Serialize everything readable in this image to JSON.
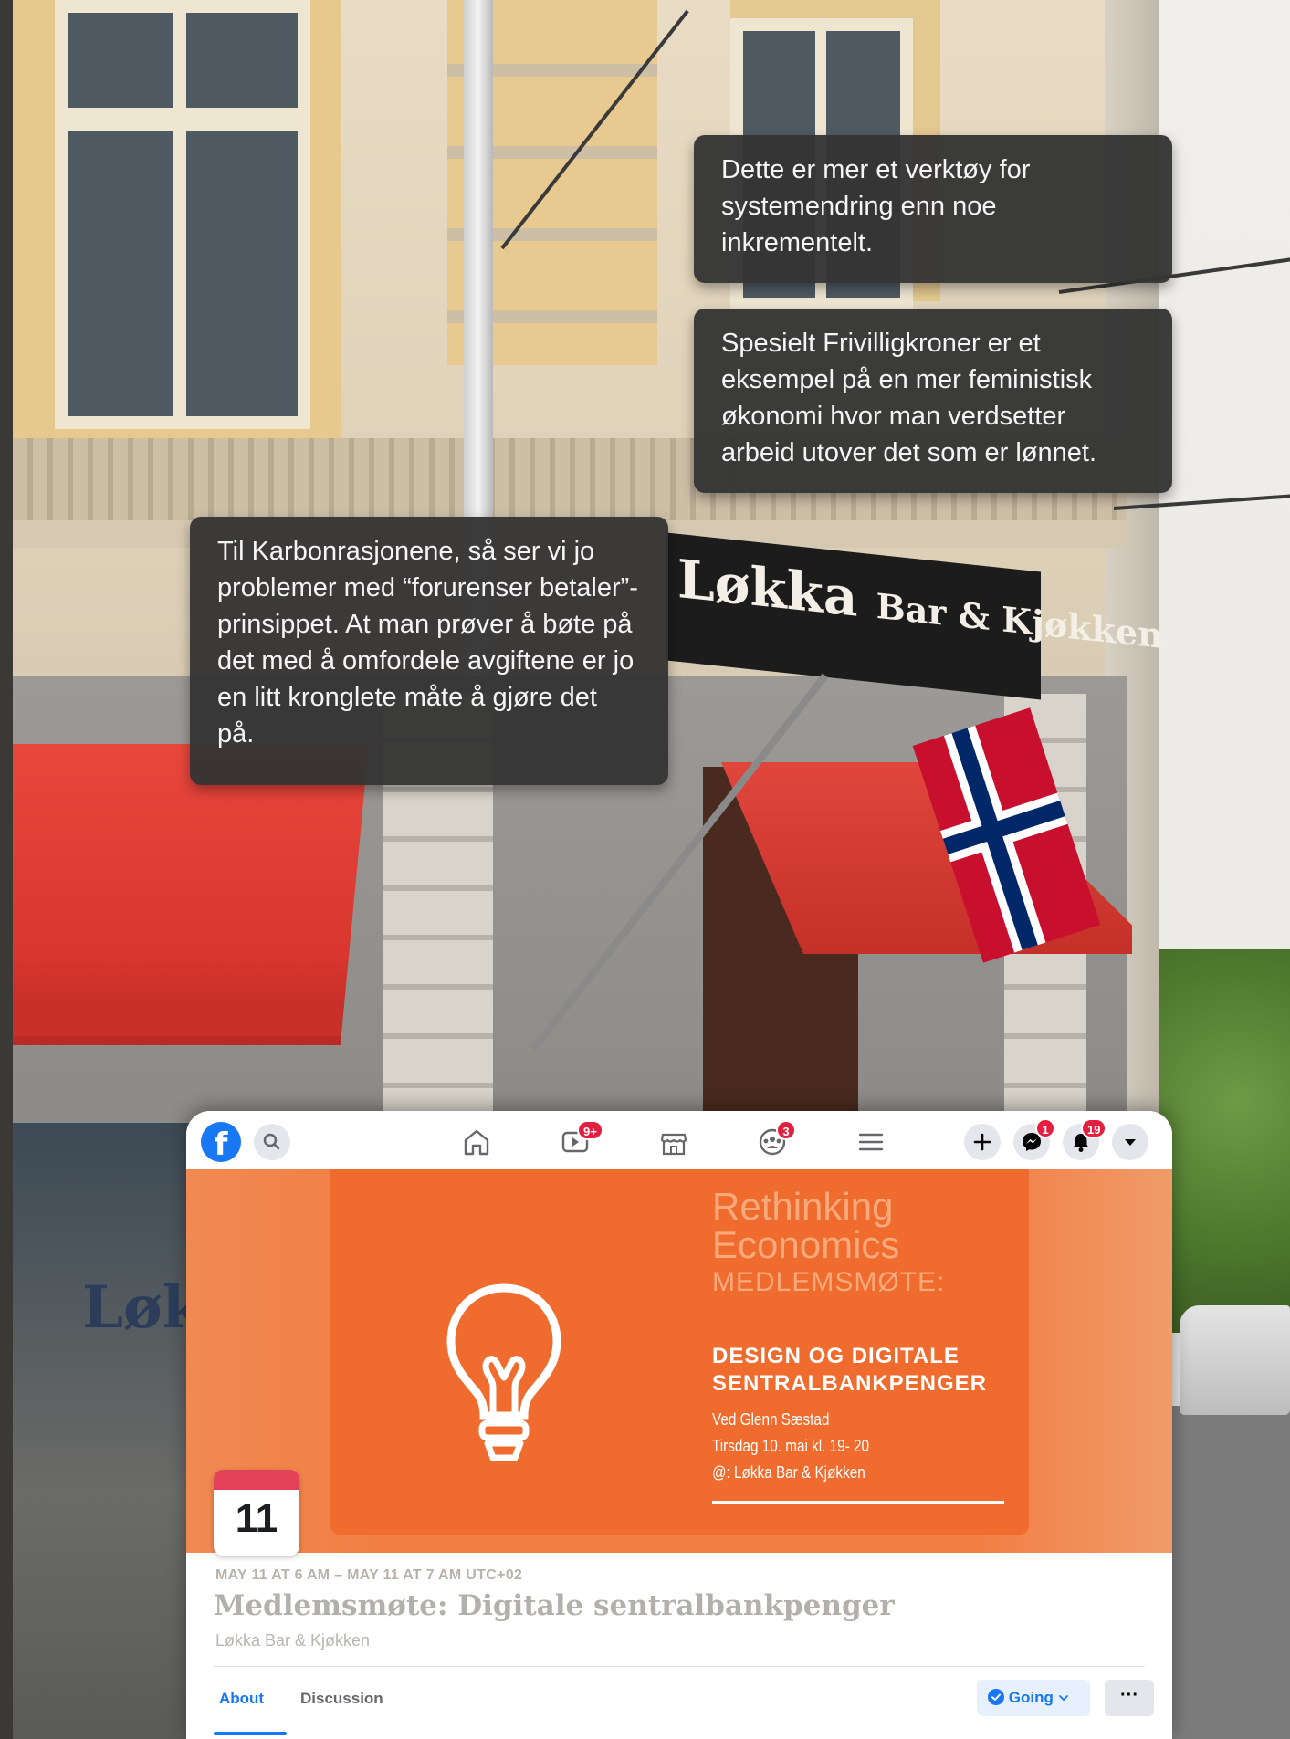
{
  "speech_bubbles": [
    "Dette er mer et verktøy for systemendring enn noe inkrementelt.",
    "Spesielt Frivilligkroner er et eksempel på en mer feministisk økonomi hvor man verdsetter arbeid utover det som er lønnet.",
    "Til Karbonrasjonene, så ser vi jo problemer med “forurenser betaler”-prinsippet. At man prøver å bøte på det med å omfordele avgiftene er jo en litt kronglete måte å gjøre det på."
  ],
  "background": {
    "sign_text_main": "Løkka",
    "sign_text_sub": "Bar & Kjøkken",
    "lower_sign_text": "Løk"
  },
  "topbar": {
    "logo": "f",
    "watch_badge": "9+",
    "groups_badge": "3",
    "messenger_badge": "1",
    "notifications_badge": "19"
  },
  "poster": {
    "title_line1": "Rethinking",
    "title_line2": "Economics",
    "subtitle": "MEDLEMSMØTE:",
    "headline_line1": "DESIGN OG DIGITALE",
    "headline_line2": "SENTRALBANKPENGER",
    "detail_line1": "Ved Glenn Sæstad",
    "detail_line2": "Tirsdag 10. mai kl. 19- 20",
    "detail_line3": "@: Løkka Bar & Kjøkken"
  },
  "event": {
    "day": "11",
    "datetime": "MAY 11 AT 6 AM – MAY 11 AT 7 AM UTC+02",
    "title": "Medlemsmøte: Digitale sentralbankpenger",
    "location": "Løkka Bar & Kjøkken"
  },
  "tabs": {
    "about": "About",
    "discussion": "Discussion"
  },
  "actions": {
    "going": "Going",
    "more": "···"
  },
  "colors": {
    "facebook_blue": "#1877f2",
    "badge_red": "#e41e3f",
    "poster_orange": "#ef6b2e",
    "bubble_bg": "#343434"
  },
  "icons": [
    "facebook-logo-icon",
    "search-icon",
    "home-icon",
    "watch-icon",
    "marketplace-icon",
    "groups-icon",
    "menu-icon",
    "plus-icon",
    "messenger-icon",
    "bell-icon",
    "caret-down-icon",
    "lightbulb-icon",
    "check-circle-icon",
    "chevron-down-icon"
  ]
}
